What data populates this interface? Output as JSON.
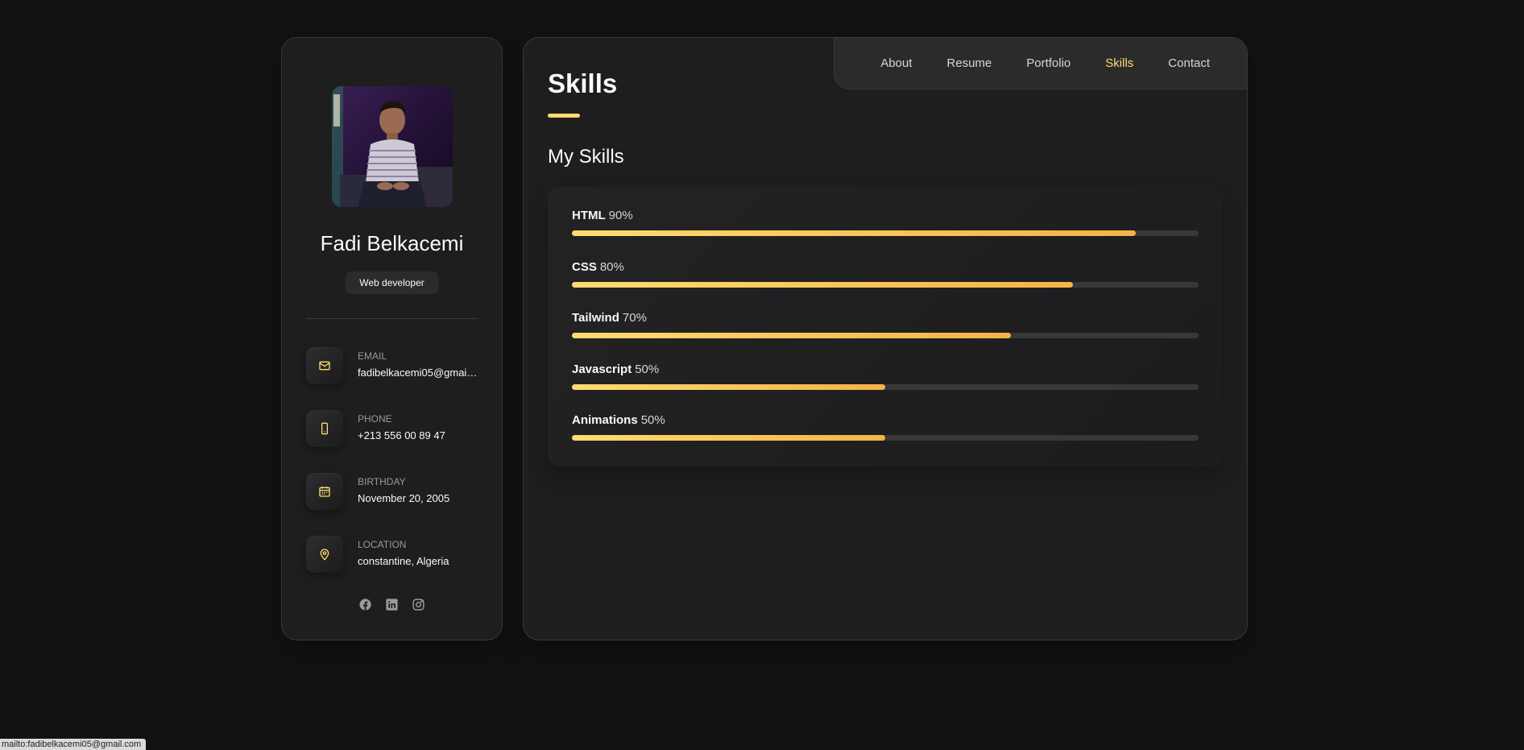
{
  "profile": {
    "name": "Fadi Belkacemi",
    "title": "Web developer",
    "avatar_alt": "avatar"
  },
  "contacts": [
    {
      "label": "EMAIL",
      "value": "fadibelkacemi05@gmail.com",
      "icon": "mail-icon"
    },
    {
      "label": "PHONE",
      "value": "+213 556 00 89 47",
      "icon": "phone-icon"
    },
    {
      "label": "BIRTHDAY",
      "value": "November 20, 2005",
      "icon": "calendar-icon"
    },
    {
      "label": "LOCATION",
      "value": "constantine, Algeria",
      "icon": "location-icon"
    }
  ],
  "socials": [
    "facebook-icon",
    "linkedin-icon",
    "instagram-icon"
  ],
  "nav": {
    "items": [
      "About",
      "Resume",
      "Portfolio",
      "Skills",
      "Contact"
    ],
    "active": "Skills"
  },
  "page": {
    "title": "Skills",
    "section_title": "My Skills"
  },
  "skills": [
    {
      "name": "HTML",
      "percent_label": "90%",
      "percent": 90
    },
    {
      "name": "CSS",
      "percent_label": "80%",
      "percent": 80
    },
    {
      "name": "Tailwind",
      "percent_label": "70%",
      "percent": 70
    },
    {
      "name": "Javascript",
      "percent_label": "50%",
      "percent": 50
    },
    {
      "name": "Animations",
      "percent_label": "50%",
      "percent": 50
    }
  ],
  "status_bar": "mailto:fadibelkacemi05@gmail.com",
  "colors": {
    "background": "#121212",
    "card": "#1e1e1f",
    "accent": "#ffdb70",
    "accent_end": "#f5b347",
    "track": "#383838"
  }
}
